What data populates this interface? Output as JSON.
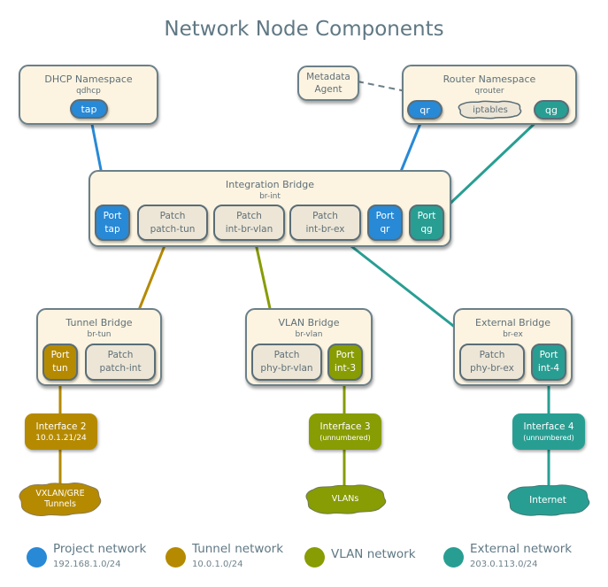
{
  "title": "Network Node Components",
  "colors": {
    "project": "#2889d6",
    "tunnel": "#b58a00",
    "vlan": "#889c04",
    "external": "#289e93",
    "box_fill": "#fcf4e1",
    "patch_fill": "#ede6d6",
    "border": "#6b8089"
  },
  "dhcp": {
    "title": "DHCP Namespace",
    "sub": "qdhcp",
    "port": "tap"
  },
  "metadata": {
    "line1": "Metadata",
    "line2": "Agent"
  },
  "router": {
    "title": "Router Namespace",
    "sub": "qrouter",
    "port_qr": "qr",
    "iptables": "iptables",
    "port_qg": "qg"
  },
  "integration": {
    "title": "Integration Bridge",
    "sub": "br-int",
    "ports": [
      {
        "l1": "Port",
        "l2": "tap"
      },
      {
        "l1": "Patch",
        "l2": "patch-tun"
      },
      {
        "l1": "Patch",
        "l2": "int-br-vlan"
      },
      {
        "l1": "Patch",
        "l2": "int-br-ex"
      },
      {
        "l1": "Port",
        "l2": "qr"
      },
      {
        "l1": "Port",
        "l2": "qg"
      }
    ]
  },
  "tunnel_bridge": {
    "title": "Tunnel Bridge",
    "sub": "br-tun",
    "port": {
      "l1": "Port",
      "l2": "tun"
    },
    "patch": {
      "l1": "Patch",
      "l2": "patch-int"
    }
  },
  "vlan_bridge": {
    "title": "VLAN Bridge",
    "sub": "br-vlan",
    "patch": {
      "l1": "Patch",
      "l2": "phy-br-vlan"
    },
    "port": {
      "l1": "Port",
      "l2": "int-3"
    }
  },
  "external_bridge": {
    "title": "External Bridge",
    "sub": "br-ex",
    "patch": {
      "l1": "Patch",
      "l2": "phy-br-ex"
    },
    "port": {
      "l1": "Port",
      "l2": "int-4"
    }
  },
  "interfaces": [
    {
      "name": "Interface 2",
      "detail": "10.0.1.21/24"
    },
    {
      "name": "Interface 3",
      "detail": "(unnumbered)"
    },
    {
      "name": "Interface 4",
      "detail": "(unnumbered)"
    }
  ],
  "clouds": [
    {
      "line1": "VXLAN/GRE",
      "line2": "Tunnels"
    },
    {
      "line1": "VLANs",
      "line2": ""
    },
    {
      "line1": "Internet",
      "line2": ""
    }
  ],
  "legend": [
    {
      "label": "Project network",
      "sub": "192.168.1.0/24"
    },
    {
      "label": "Tunnel network",
      "sub": "10.0.1.0/24"
    },
    {
      "label": "VLAN network",
      "sub": ""
    },
    {
      "label": "External network",
      "sub": "203.0.113.0/24"
    }
  ]
}
